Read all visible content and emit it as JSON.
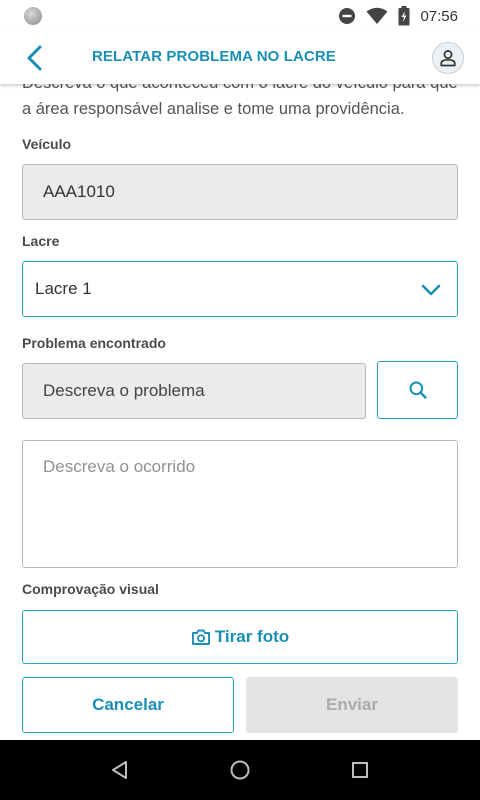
{
  "status_bar": {
    "time": "07:56"
  },
  "app_bar": {
    "title": "RELATAR PROBLEMA NO LACRE"
  },
  "intro_text": "Descreva o que aconteceu com o lacre do veículo para que a área responsável analise e tome uma providência.",
  "form": {
    "vehicle": {
      "label": "Veículo",
      "value": "AAA1010"
    },
    "seal": {
      "label": "Lacre",
      "value": "Lacre 1"
    },
    "problem": {
      "label": "Problema encontrado",
      "placeholder": "Descreva o problema"
    },
    "details": {
      "placeholder": "Descreva o ocorrido"
    },
    "evidence": {
      "label": "Comprovação visual",
      "button_label": "Tirar foto"
    }
  },
  "actions": {
    "cancel_label": "Cancelar",
    "send_label": "Enviar"
  },
  "colors": {
    "accent": "#1a8fb5",
    "border_accent": "#2aa3c6",
    "disabled_bg": "#e9ebec",
    "disabled_button_bg": "#e3e4e5"
  }
}
